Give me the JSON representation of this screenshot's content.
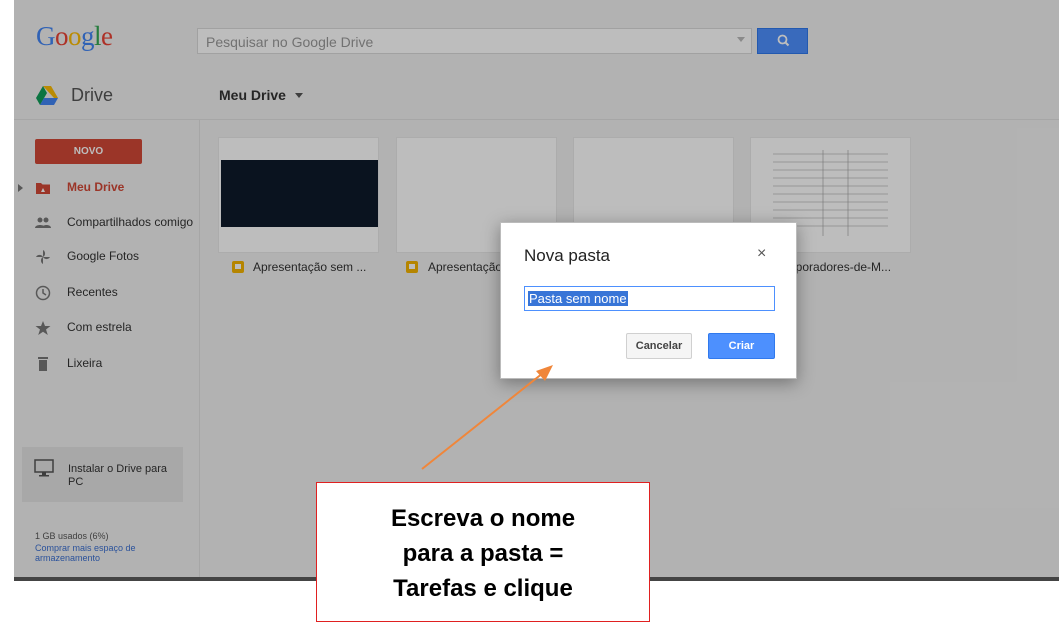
{
  "header": {
    "logo": "Google",
    "search_placeholder": "Pesquisar no Google Drive"
  },
  "subheader": {
    "app_label": "Drive",
    "location": "Meu Drive"
  },
  "sidebar": {
    "new_button": "NOVO",
    "items": [
      {
        "label": "Meu Drive",
        "icon": "drive-folder-icon",
        "active": true
      },
      {
        "label": "Compartilhados comigo",
        "icon": "people-icon"
      },
      {
        "label": "Google Fotos",
        "icon": "photos-pinwheel-icon"
      },
      {
        "label": "Recentes",
        "icon": "clock-icon"
      },
      {
        "label": "Com estrela",
        "icon": "star-icon"
      },
      {
        "label": "Lixeira",
        "icon": "trash-icon"
      }
    ],
    "install_label": "Instalar o Drive para PC",
    "storage_used": "1 GB usados (6%)",
    "storage_link": "Comprar mais espaço de armazenamento"
  },
  "files": [
    {
      "name": "Apresentação sem ...",
      "type": "slides"
    },
    {
      "name": "Apresentação",
      "type": "slides"
    },
    {
      "name": "",
      "type": "blank"
    },
    {
      "name": "aporadores-de-M...",
      "type": "document"
    }
  ],
  "dialog": {
    "title": "Nova pasta",
    "close": "×",
    "input_value": "Pasta sem nome",
    "cancel_label": "Cancelar",
    "create_label": "Criar"
  },
  "callout": {
    "lines": [
      "Escreva o nome",
      "para a pasta =",
      "Tarefas e clique"
    ]
  },
  "colors": {
    "accent_blue": "#4d90fe",
    "new_button_red": "#d14836",
    "callout_border": "#e02020",
    "arrow": "#f0863a"
  }
}
